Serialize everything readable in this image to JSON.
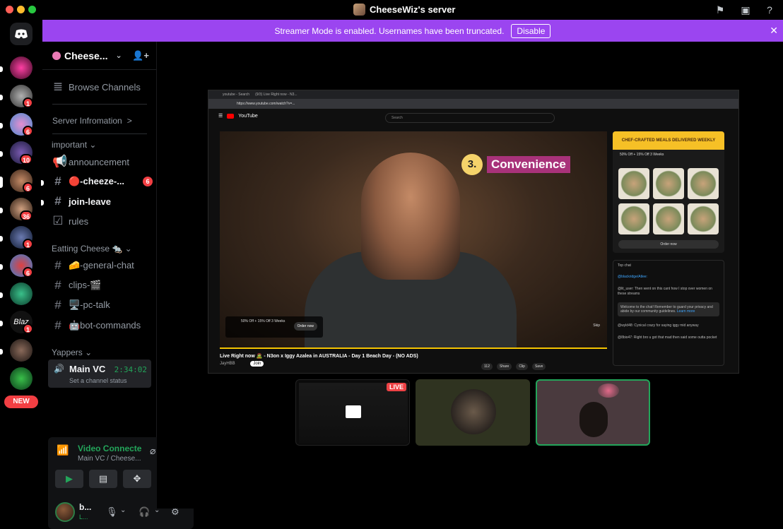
{
  "window": {
    "title": "CheeseWiz's server",
    "traffic_colors": [
      "#ff5f57",
      "#febc2e",
      "#28c840"
    ]
  },
  "banner": {
    "text": "Streamer Mode is enabled. Usernames have been truncated.",
    "button": "Disable",
    "color": "#9b45f0"
  },
  "rail": {
    "servers": [
      {
        "badge": ""
      },
      {
        "badge": "1"
      },
      {
        "badge": "6"
      },
      {
        "badge": "10"
      },
      {
        "badge": "6"
      },
      {
        "badge": "36"
      },
      {
        "badge": "1"
      },
      {
        "badge": "6"
      },
      {
        "badge": ""
      },
      {
        "badge": "1"
      },
      {
        "badge": ""
      }
    ],
    "new_pill": "NEW"
  },
  "sidebar": {
    "server_name": "Cheese...",
    "browse": "Browse Channels",
    "server_info": "Server Infromation",
    "server_info_chevron": ">",
    "cat_important": "important",
    "ch_announcement": "announcement",
    "ch_cheeze": "🔴-cheeze-...",
    "ch_cheeze_count": "6",
    "ch_joinleave": "join-leave",
    "ch_rules": "rules",
    "cat_eating": "Eatting Cheese 🐀",
    "ch_general": "🧀-general-chat",
    "ch_clips": "clips-🎬",
    "ch_pctalk": "🖥️-pc-talk",
    "ch_botcmds": "🤖bot-commands",
    "cat_yappers": "Yappers",
    "vc_name": "Main VC",
    "vc_time": "2:34:02",
    "vc_status": "Set a channel status"
  },
  "voice_panel": {
    "title": "Video Connecte",
    "subtitle": "Main VC / Cheese...",
    "username": "b...",
    "user_status": "L..."
  },
  "stream": {
    "tabs": [
      "youtube - Search",
      "(9/3) Live Right now - N3..."
    ],
    "url": "https://www.youtube.com/watch?v=...",
    "yt_search_placeholder": "Search",
    "overlay_number": "3.",
    "overlay_text": "Convenience",
    "ad_text": "50% Off + 15% Off 3 Weeks",
    "ad_button": "Order now",
    "skip": "Skip",
    "video_title": "Live Right now 🧟 - N3on x Iggy Azalea in AUSTRALIA - Day 1 Beach Day - (NO ADS)",
    "channel": "JayHBB",
    "join": "Join",
    "actions": [
      "112",
      "Share",
      "Clip",
      "Save"
    ],
    "side_ad_header": "CHEF-CRAFTED MEALS DELIVERED WEEKLY",
    "side_ad_text": "50% Off + 15% Off 3 Weeks",
    "side_ad_button": "Order now",
    "chat_header": "Top chat",
    "chat_msgs": [
      "@blackridge/Atlee: ",
      "@lit_user: Then went on this cant how I stop over women on these streams",
      "Welcome to the chat! Remember to guard your privacy and abide by our community guidelines.",
      "@wyld48: Cynical crazy for saying iggy mid anyway",
      "@8bio47: Right bro u got that mad then said some outta pocket"
    ],
    "pinned_link": "Learn more"
  },
  "tiles": {
    "live_badge": "LIVE"
  }
}
